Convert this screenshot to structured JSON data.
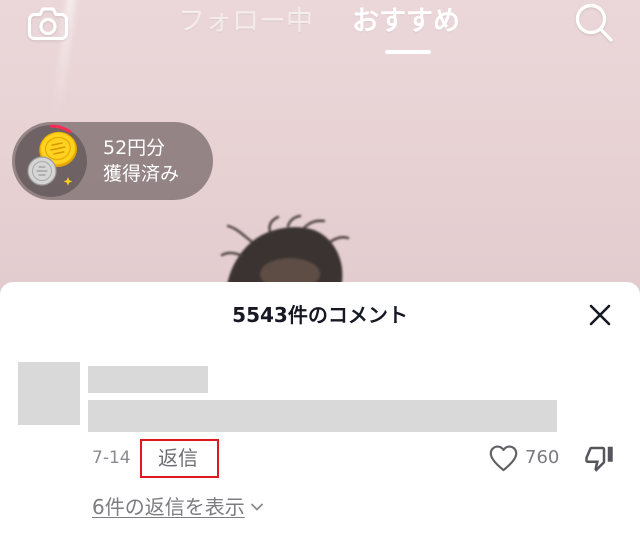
{
  "nav": {
    "camera_icon": "camera-icon",
    "tabs": [
      {
        "label": "フォロー中",
        "active": false
      },
      {
        "label": "おすすめ",
        "active": true
      }
    ],
    "search_icon": "search-icon"
  },
  "reward": {
    "icon": "coin-icon",
    "progress": 0.09,
    "amount": "52円分",
    "status": "獲得済み"
  },
  "comments": {
    "title": "5543件のコメント",
    "close_icon": "close-icon",
    "items": [
      {
        "date": "7-14",
        "reply_label": "返信",
        "reply_highlighted": true,
        "like_icon": "heart-icon",
        "like_count": "760",
        "dislike_icon": "thumbs-down-icon",
        "view_replies_label": "6件の返信を表示",
        "view_replies_icon": "chevron-down-icon"
      }
    ]
  },
  "colors": {
    "highlight": "#e0191e",
    "progress_ring": "#fe2c55",
    "sheet_background": "#ffffff",
    "text_primary": "#161823",
    "text_secondary": "#8a8b91",
    "placeholder": "#d9d9d9",
    "video_background": "#e4ced0"
  }
}
